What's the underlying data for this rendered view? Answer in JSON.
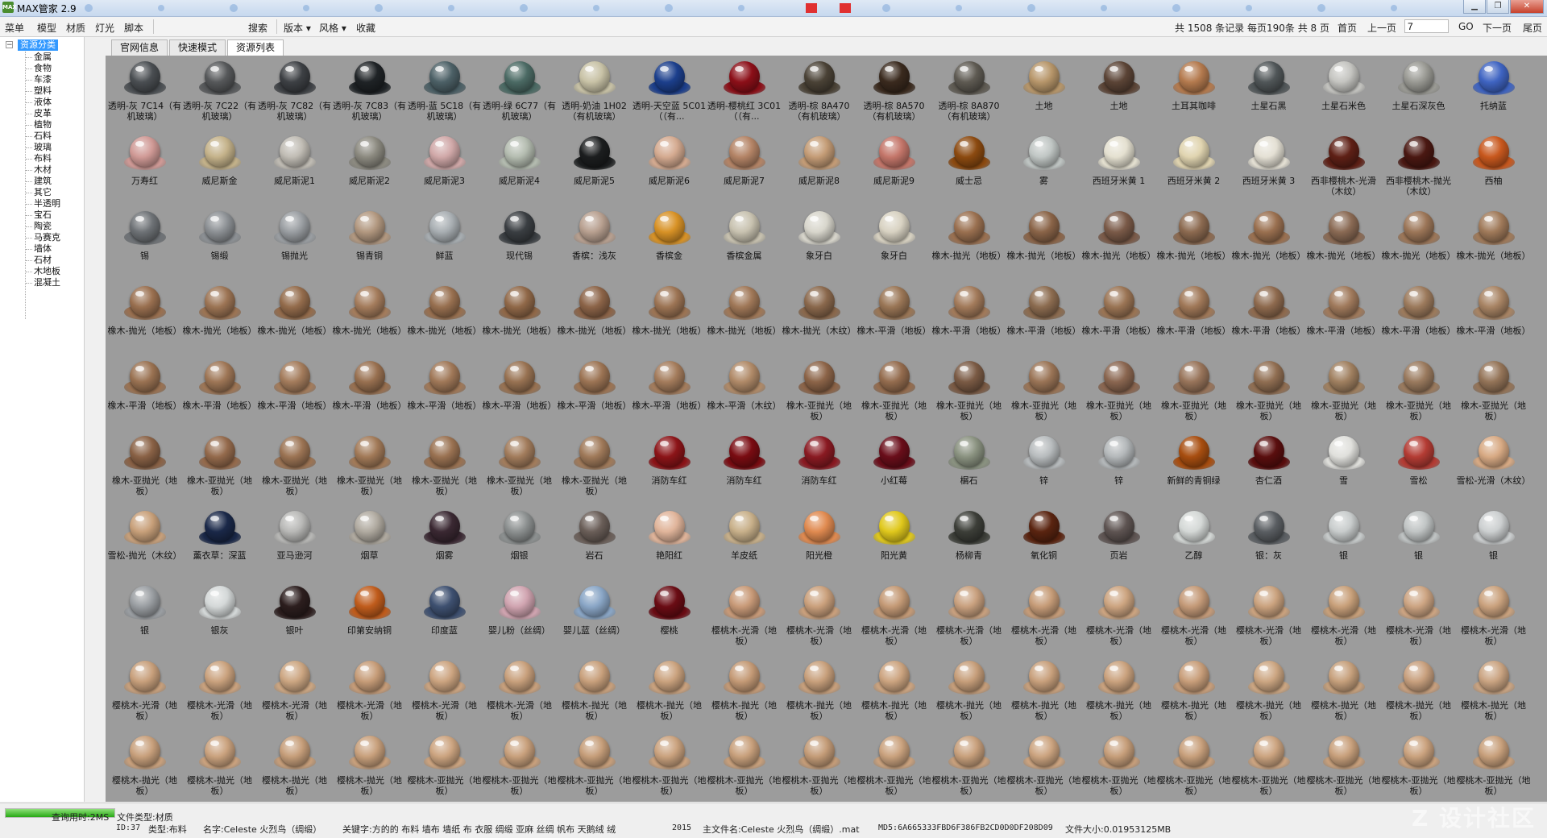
{
  "window": {
    "title": "MAX管家 2.9",
    "logo": "MAX"
  },
  "menu": {
    "items": [
      "菜单",
      "模型",
      "材质",
      "灯光",
      "脚本"
    ],
    "search": "搜索",
    "dropdowns": [
      "版本 ▾",
      "风格 ▾"
    ],
    "favorites": "收藏",
    "pager": {
      "summary": "共 1508 条记录 每页190条 共 8 页",
      "first": "首页",
      "prev": "上一页",
      "current": "7",
      "go": "GO",
      "next": "下一页",
      "last": "尾页"
    }
  },
  "sidebar": {
    "root": "资源分类",
    "items": [
      "金属",
      "食物",
      "车漆",
      "塑料",
      "液体",
      "皮革",
      "植物",
      "石料",
      "玻璃",
      "布料",
      "木材",
      "建筑",
      "其它",
      "半透明",
      "宝石",
      "陶瓷",
      "马赛克",
      "墙体",
      "石材",
      "木地板",
      "混凝土"
    ]
  },
  "tabs": [
    "官网信息",
    "快速模式",
    "资源列表"
  ],
  "grid": {
    "rows": [
      [
        "透明-灰 7C14（有机玻璃）",
        "透明-灰 7C22（有机玻璃）",
        "透明-灰 7C82（有机玻璃）",
        "透明-灰 7C83（有机玻璃）",
        "透明-蓝 5C18（有机玻璃）",
        "透明-绿 6C77（有机玻璃）",
        "透明-奶油 1H02（有机玻璃）",
        "透明-天空蓝 5C01（（有...",
        "透明-樱桃红 3C01（（有...",
        "透明-棕 8A470（有机玻璃）",
        "透明-棕 8A570（有机玻璃）",
        "透明-棕 8A870（有机玻璃）",
        "土地",
        "土地",
        "土耳其咖啡",
        "土星石黑",
        "土星石米色",
        "土星石深灰色",
        "托纳蓝"
      ],
      [
        "万寿红",
        "威尼斯金",
        "威尼斯泥1",
        "威尼斯泥2",
        "威尼斯泥3",
        "威尼斯泥4",
        "威尼斯泥5",
        "威尼斯泥6",
        "威尼斯泥7",
        "威尼斯泥8",
        "威尼斯泥9",
        "威士忌",
        "雾",
        "西班牙米黄 1",
        "西班牙米黄 2",
        "西班牙米黄 3",
        "西非樱桃木-光滑（木纹）",
        "西非樱桃木-抛光（木纹）",
        "西柚"
      ],
      [
        "锡",
        "锡缎",
        "锡抛光",
        "锡青铜",
        "鲜蓝",
        "现代锡",
        "香槟：浅灰",
        "香槟金",
        "香槟金属",
        "象牙白",
        "象牙白",
        "橡木-抛光（地板）",
        "橡木-抛光（地板）",
        "橡木-抛光（地板）",
        "橡木-抛光（地板）",
        "橡木-抛光（地板）",
        "橡木-抛光（地板）",
        "橡木-抛光（地板）",
        "橡木-抛光（地板）"
      ],
      [
        "橡木-抛光（地板）",
        "橡木-抛光（地板）",
        "橡木-抛光（地板）",
        "橡木-抛光（地板）",
        "橡木-抛光（地板）",
        "橡木-抛光（地板）",
        "橡木-抛光（地板）",
        "橡木-抛光（地板）",
        "橡木-抛光（地板）",
        "橡木-抛光（木纹）",
        "橡木-平滑（地板）",
        "橡木-平滑（地板）",
        "橡木-平滑（地板）",
        "橡木-平滑（地板）",
        "橡木-平滑（地板）",
        "橡木-平滑（地板）",
        "橡木-平滑（地板）",
        "橡木-平滑（地板）",
        "橡木-平滑（地板）"
      ],
      [
        "橡木-平滑（地板）",
        "橡木-平滑（地板）",
        "橡木-平滑（地板）",
        "橡木-平滑（地板）",
        "橡木-平滑（地板）",
        "橡木-平滑（地板）",
        "橡木-平滑（地板）",
        "橡木-平滑（地板）",
        "橡木-平滑（木纹）",
        "橡木-亚抛光（地板）",
        "橡木-亚抛光（地板）",
        "橡木-亚抛光（地板）",
        "橡木-亚抛光（地板）",
        "橡木-亚抛光（地板）",
        "橡木-亚抛光（地板）",
        "橡木-亚抛光（地板）",
        "橡木-亚抛光（地板）",
        "橡木-亚抛光（地板）",
        "橡木-亚抛光（地板）"
      ],
      [
        "橡木-亚抛光（地板）",
        "橡木-亚抛光（地板）",
        "橡木-亚抛光（地板）",
        "橡木-亚抛光（地板）",
        "橡木-亚抛光（地板）",
        "橡木-亚抛光（地板）",
        "橡木-亚抛光（地板）",
        "消防车红",
        "消防车红",
        "消防车红",
        "小红莓",
        "榍石",
        "锌",
        "锌",
        "新鲜的青铜绿",
        "杏仁酒",
        "雪",
        "雪松",
        "雪松-光滑（木纹）"
      ],
      [
        "雪松-抛光（木纹）",
        "薰衣草：深蓝",
        "亚马逊河",
        "烟草",
        "烟雾",
        "烟银",
        "岩石",
        "艳阳红",
        "羊皮纸",
        "阳光橙",
        "阳光黄",
        "杨柳青",
        "氧化铜",
        "页岩",
        "乙醇",
        "银：灰",
        "银",
        "银",
        "银"
      ],
      [
        "银",
        "银灰",
        "银叶",
        "印第安纳铜",
        "印度蓝",
        "婴儿粉（丝绸）",
        "婴儿蓝（丝绸）",
        "樱桃",
        "樱桃木-光滑（地板）",
        "樱桃木-光滑（地板）",
        "樱桃木-光滑（地板）",
        "樱桃木-光滑（地板）",
        "樱桃木-光滑（地板）",
        "樱桃木-光滑（地板）",
        "樱桃木-光滑（地板）",
        "樱桃木-光滑（地板）",
        "樱桃木-光滑（地板）",
        "樱桃木-光滑（地板）",
        "樱桃木-光滑（地板）"
      ],
      [
        "樱桃木-光滑（地板）",
        "樱桃木-光滑（地板）",
        "樱桃木-光滑（地板）",
        "樱桃木-光滑（地板）",
        "樱桃木-光滑（地板）",
        "樱桃木-光滑（地板）",
        "樱桃木-抛光（地板）",
        "樱桃木-抛光（地板）",
        "樱桃木-抛光（地板）",
        "樱桃木-抛光（地板）",
        "樱桃木-抛光（地板）",
        "樱桃木-抛光（地板）",
        "樱桃木-抛光（地板）",
        "樱桃木-抛光（地板）",
        "樱桃木-抛光（地板）",
        "樱桃木-抛光（地板）",
        "樱桃木-抛光（地板）",
        "樱桃木-抛光（地板）",
        "樱桃木-抛光（地板）"
      ],
      [
        "樱桃木-抛光（地板）",
        "樱桃木-抛光（地板）",
        "樱桃木-抛光（地板）",
        "樱桃木-抛光（地板）",
        "樱桃木-亚抛光（地板）",
        "樱桃木-亚抛光（地板）",
        "樱桃木-亚抛光（地板）",
        "樱桃木-亚抛光（地板）",
        "樱桃木-亚抛光（地板）",
        "樱桃木-亚抛光（地板）",
        "樱桃木-亚抛光（地板）",
        "樱桃木-亚抛光（地板）",
        "樱桃木-亚抛光（地板）",
        "樱桃木-亚抛光（地板）",
        "樱桃木-亚抛光（地板）",
        "樱桃木-亚抛光（地板）",
        "樱桃木-亚抛光（地板）",
        "樱桃木-亚抛光（地板）",
        "樱桃木-亚抛光（地板）"
      ]
    ],
    "colors": [
      [
        "#4a4e52",
        "#56585a",
        "#3d4044",
        "#1f2326",
        "#4c6066",
        "#4b6a64",
        "#c8c2a6",
        "#1c3f8c",
        "#8c0f18",
        "#4a4236",
        "#3a2a1e",
        "#5e5a52",
        "#b7966a",
        "#5b4436",
        "#b47a4e",
        "#505658",
        "#c4c4c0",
        "#9a9a94",
        "#3f64c2"
      ],
      [
        "#d09a96",
        "#c4b28a",
        "#c0bcb4",
        "#8c8a80",
        "#d0a8a8",
        "#b4bcb0",
        "#1c1e1f",
        "#d4aa90",
        "#b48466",
        "#c49c76",
        "#c4766a",
        "#8c4a10",
        "#c0c6c4",
        "#e4e0d0",
        "#e0d4b0",
        "#e4e0d4",
        "#5e2016",
        "#4a1812",
        "#c8581e"
      ],
      [
        "#6e7276",
        "#8c9094",
        "#9a9ea2",
        "#b29880",
        "#a8aeb2",
        "#3a3e42",
        "#b8a090",
        "#d89226",
        "#c8c2b0",
        "#d8d6cc",
        "#d8d2c2",
        "#9a7050",
        "#8a6448",
        "#7a5a48",
        "#8c6a50",
        "#9a7050",
        "#8a6a54",
        "#9c7658",
        "#a07a5a"
      ],
      [
        "#9a7050",
        "#9c7454",
        "#946c4c",
        "#a47c5c",
        "#987050",
        "#906848",
        "#8c6448",
        "#9c7454",
        "#a07858",
        "#8a684c",
        "#9a7656",
        "#a27a5a",
        "#8c6c50",
        "#9a7454",
        "#a07858",
        "#8e6a4e",
        "#a07a5c",
        "#9c7a5c",
        "#a88464"
      ],
      [
        "#9a7252",
        "#9e7656",
        "#a47c5c",
        "#987050",
        "#a07858",
        "#987252",
        "#9c7454",
        "#a47c5c",
        "#b08a68",
        "#8c6448",
        "#946c4e",
        "#7a5a44",
        "#9a7456",
        "#8a6650",
        "#98745a",
        "#906e52",
        "#a08060",
        "#9a7a5e",
        "#947458"
      ],
      [
        "#8a6246",
        "#946a4c",
        "#9c7454",
        "#a27a58",
        "#9a7252",
        "#a27c5c",
        "#a07a5a",
        "#8c1418",
        "#7a0c12",
        "#8a1a22",
        "#6a0e1a",
        "#8a9280",
        "#b8bcbe",
        "#b4b8ba",
        "#a84e10",
        "#5a0e0e",
        "#e0e0dc",
        "#b43c34",
        "#d8aa84"
      ],
      [
        "#c8a07a",
        "#1a2848",
        "#b8b8b6",
        "#b0aaa0",
        "#3a2832",
        "#8c9090",
        "#6a5e58",
        "#e0b49a",
        "#c8b08a",
        "#e08a50",
        "#e0c81c",
        "#3c3e38",
        "#5a2410",
        "#5e5452",
        "#d4d8d6",
        "#5a5e62",
        "#c8cccc",
        "#c0c4c4",
        "#cccfd0"
      ],
      [
        "#9a9ea2",
        "#d4d8d8",
        "#2c1e1e",
        "#c05c1c",
        "#3e5070",
        "#d0a4b0",
        "#8aa6c6",
        "#6a0c14",
        "#c89a78",
        "#caa07c",
        "#c49a76",
        "#c8a07e",
        "#c69c78",
        "#cca480",
        "#c49a78",
        "#caa27e",
        "#c8a07a",
        "#cca482",
        "#caa27e"
      ],
      [
        "#c8a07c",
        "#caa27e",
        "#cca682",
        "#c69c78",
        "#cca480",
        "#c8a07c",
        "#c8a07c",
        "#caa27e",
        "#c49a76",
        "#c8a07c",
        "#cca480",
        "#c69e7a",
        "#c8a07c",
        "#caa27e",
        "#c89e7a",
        "#cca682",
        "#c6a07c",
        "#c8a07e",
        "#caa482"
      ],
      [
        "#c8a07c",
        "#caa27e",
        "#c69e7a",
        "#c8a07c",
        "#cca480",
        "#c8a07c",
        "#c69e7a",
        "#caa27e",
        "#c8a07c",
        "#c49c78",
        "#caa27e",
        "#c8a07c",
        "#cca480",
        "#c69e7a",
        "#c8a07c",
        "#cca480",
        "#c8a07c",
        "#caa27e",
        "#c8a07c"
      ]
    ]
  },
  "status": {
    "query_time": "查询用时:2MS",
    "file_type": "文件类型:材质",
    "id": "ID:37",
    "category": "类型:布料",
    "name": "名字:Celeste 火烈鸟（绸缎）",
    "keywords": "关键字:方的的 布料 墙布 墙纸 布 衣服 绸缎 亚麻 丝绸 帆布 天鹅绒 绒",
    "year": "2015",
    "main_file": "主文件名:Celeste 火烈鸟（绸缎）.mat",
    "md5": "MD5:6A665333FBD6F386FB2CD0D0DF208D09",
    "file_size": "文件大小:0.01953125MB",
    "progress": 1.0
  },
  "watermark": "Z 设计社区"
}
